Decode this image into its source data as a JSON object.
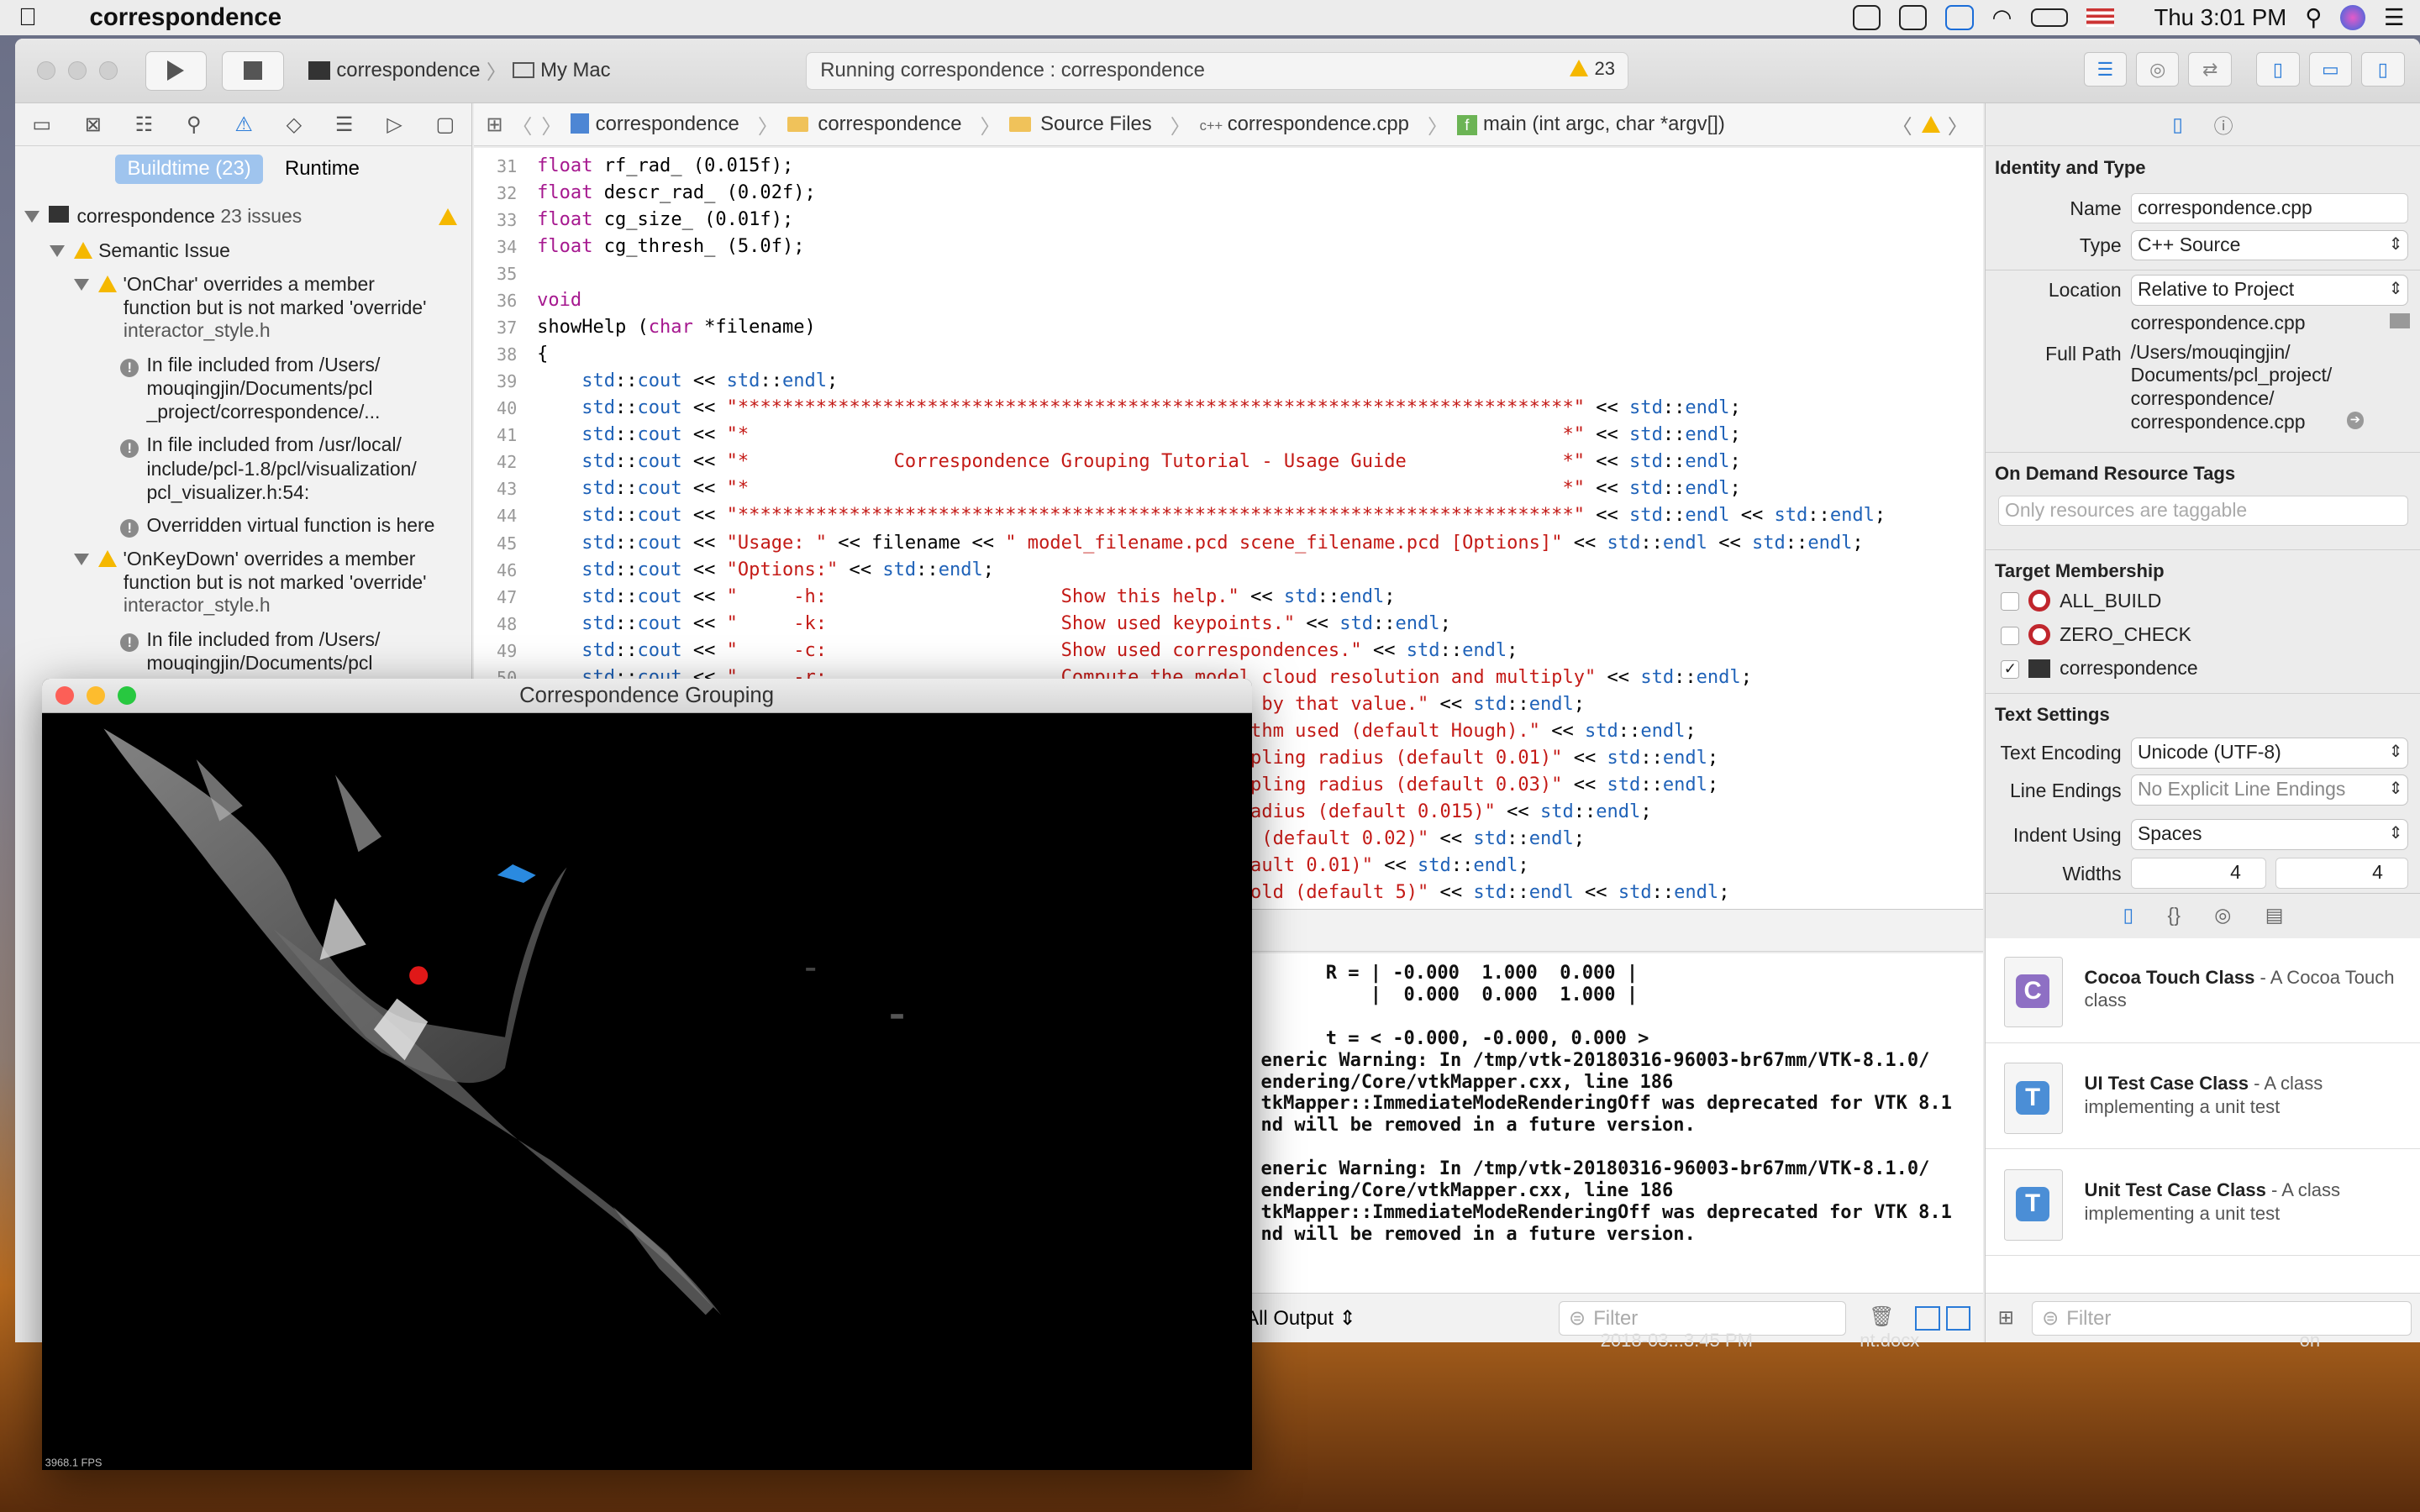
{
  "menubar": {
    "app": "correspondence",
    "clock": "Thu 3:01 PM"
  },
  "toolbar": {
    "scheme": "correspondence",
    "destination": "My Mac",
    "activity": "Running correspondence : correspondence",
    "warnings": "23"
  },
  "navigator": {
    "tabs": [
      "Buildtime (23)",
      "Runtime"
    ],
    "project": "correspondence",
    "project_issues": "23 issues",
    "group": "Semantic Issue",
    "items": [
      {
        "l1": "'OnChar' overrides a member",
        "l2": "function but is not marked 'override'",
        "file": "interactor_style.h"
      },
      {
        "l1": "In file included from /Users/",
        "l2": "mouqingjin/Documents/pcl",
        "l3": "_project/correspondence/..."
      },
      {
        "l1": "In file included from /usr/local/",
        "l2": "include/pcl-1.8/pcl/visualization/",
        "l3": "pcl_visualizer.h:54:"
      },
      {
        "l1": "Overridden virtual function is here"
      },
      {
        "l1": "'OnKeyDown' overrides a member",
        "l2": "function but is not marked 'override'",
        "file": "interactor_style.h"
      },
      {
        "l1": "In file included from /Users/",
        "l2": "mouqingjin/Documents/pcl"
      }
    ]
  },
  "jumpbar": [
    "correspondence",
    "correspondence",
    "Source Files",
    "correspondence.cpp",
    "main (int argc, char *argv[])"
  ],
  "code": [
    {
      "n": "31",
      "t": "float rf_rad_ (0.015f);"
    },
    {
      "n": "32",
      "t": "float descr_rad_ (0.02f);"
    },
    {
      "n": "33",
      "t": "float cg_size_ (0.01f);"
    },
    {
      "n": "34",
      "t": "float cg_thresh_ (5.0f);"
    },
    {
      "n": "35",
      "t": ""
    },
    {
      "n": "36",
      "t": "void"
    },
    {
      "n": "37",
      "t": "showHelp (char *filename)"
    },
    {
      "n": "38",
      "t": "{"
    },
    {
      "n": "39",
      "t": "    std::cout << std::endl;"
    },
    {
      "n": "40",
      "t": "    std::cout << \"***************************************************************************\" << std::endl;"
    },
    {
      "n": "41",
      "t": "    std::cout << \"*                                                                         *\" << std::endl;"
    },
    {
      "n": "42",
      "t": "    std::cout << \"*             Correspondence Grouping Tutorial - Usage Guide              *\" << std::endl;"
    },
    {
      "n": "43",
      "t": "    std::cout << \"*                                                                         *\" << std::endl;"
    },
    {
      "n": "44",
      "t": "    std::cout << \"***************************************************************************\" << std::endl << std::endl;"
    },
    {
      "n": "45",
      "t": "    std::cout << \"Usage: \" << filename << \" model_filename.pcd scene_filename.pcd [Options]\" << std::endl << std::endl;"
    },
    {
      "n": "46",
      "t": "    std::cout << \"Options:\" << std::endl;"
    },
    {
      "n": "47",
      "t": "    std::cout << \"     -h:                     Show this help.\" << std::endl;"
    },
    {
      "n": "48",
      "t": "    std::cout << \"     -k:                     Show used keypoints.\" << std::endl;"
    },
    {
      "n": "49",
      "t": "    std::cout << \"     -c:                     Show used correspondences.\" << std::endl;"
    },
    {
      "n": "50",
      "t": "    std::cout << \"     -r:                     Compute the model cloud resolution and multiply\" << std::endl;"
    },
    {
      "n": "51",
      "t": "    std::cout << \"                             each radius given by that value.\" << std::endl;"
    },
    {
      "n": "52",
      "t": "    std::cout << \"     --algorithm (Hough|GC): Clustering algorithm used (default Hough).\" << std::endl;"
    },
    {
      "n": "53",
      "t": "    std::cout << \"     --model_ss val:         Model uniform sampling radius (default 0.01)\" << std::endl;"
    },
    {
      "n": "54",
      "t": "    std::cout << \"     --scene_ss val:         Scene uniform sampling radius (default 0.03)\" << std::endl;"
    },
    {
      "n": "55",
      "t": "    std::cout << \"     --rf_rad val:           Reference frame radius (default 0.015)\" << std::endl;"
    },
    {
      "n": "56",
      "t": "    std::cout << \"     --descr_rad val:        Descriptor radius (default 0.02)\" << std::endl;"
    },
    {
      "n": "57",
      "t": "    std::cout << \"     --cg_size val:          Cluster size (default 0.01)\" << std::endl;"
    },
    {
      "n": "58",
      "t": "    std::cout << \"     --cg_thresh val:        Clustering threshold (default 5)\" << std::endl << std::endl;"
    }
  ],
  "console": [
    "R = | -0.000  1.000  0.000 |",
    "    |  0.000  0.000  1.000 |",
    "",
    "t = < -0.000, -0.000, 0.000 >",
    "eneric Warning: In /tmp/vtk-20180316-96003-br67mm/VTK-8.1.0/",
    "endering/Core/vtkMapper.cxx, line 186",
    "tkMapper::ImmediateModeRenderingOff was deprecated for VTK 8.1",
    "nd will be removed in a future version.",
    "",
    "eneric Warning: In /tmp/vtk-20180316-96003-br67mm/VTK-8.1.0/",
    "endering/Core/vtkMapper.cxx, line 186",
    "tkMapper::ImmediateModeRenderingOff was deprecated for VTK 8.1",
    "nd will be removed in a future version."
  ],
  "console_bar": {
    "output": "All Output",
    "filter_ph": "Filter"
  },
  "inspector": {
    "h_identity": "Identity and Type",
    "name_label": "Name",
    "name": "correspondence.cpp",
    "type_label": "Type",
    "type": "C++ Source",
    "location_label": "Location",
    "location": "Relative to Project",
    "location_file": "correspondence.cpp",
    "fullpath_label": "Full Path",
    "fullpath": [
      "/Users/mouqingjin/",
      "Documents/pcl_project/",
      "correspondence/",
      "correspondence.cpp"
    ],
    "h_odr": "On Demand Resource Tags",
    "odr_ph": "Only resources are taggable",
    "h_target": "Target Membership",
    "targets": [
      {
        "name": "ALL_BUILD",
        "checked": false
      },
      {
        "name": "ZERO_CHECK",
        "checked": false
      },
      {
        "name": "correspondence",
        "checked": true
      }
    ],
    "h_text": "Text Settings",
    "enc_label": "Text Encoding",
    "enc": "Unicode (UTF-8)",
    "le_label": "Line Endings",
    "le": "No Explicit Line Endings",
    "indent_label": "Indent Using",
    "indent": "Spaces",
    "widths_label": "Widths",
    "tab": "4",
    "indent_w": "4",
    "library": [
      {
        "letter": "C",
        "title": "Cocoa Touch Class",
        "desc": " - A Cocoa Touch class",
        "color": "#8e6fc4"
      },
      {
        "letter": "T",
        "title": "UI Test Case Class",
        "desc": " - A class implementing a unit test",
        "color": "#4b8ed6"
      },
      {
        "letter": "T",
        "title": "Unit Test Case Class",
        "desc": " - A class implementing a unit test",
        "color": "#4b8ed6"
      }
    ],
    "filter_ph": "Filter"
  },
  "vtk": {
    "title": "Correspondence Grouping",
    "fps": "3968.1 FPS"
  },
  "desktop": {
    "file1": "2018-03...3.45 PM",
    "file2": "nt.docx",
    "file3": "on"
  }
}
